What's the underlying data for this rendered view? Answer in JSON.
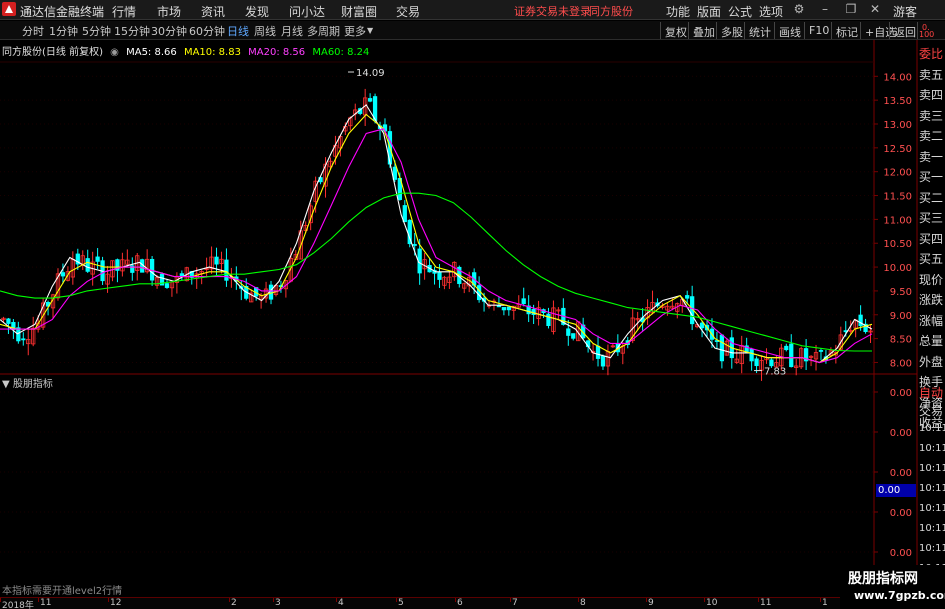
{
  "app": {
    "title": "通达信金融终端",
    "menu": [
      "行情",
      "市场",
      "资讯",
      "发现",
      "问小达",
      "财富圈",
      "交易"
    ],
    "notice": "证券交易未登录",
    "notice_stock": "同方股份",
    "right_menu": [
      "功能",
      "版面",
      "公式",
      "选项"
    ],
    "user": "游客"
  },
  "periods": {
    "tabs": [
      "分时",
      "1分钟",
      "5分钟",
      "15分钟",
      "30分钟",
      "60分钟",
      "日线",
      "周线",
      "月线",
      "多周期",
      "更多"
    ],
    "active": "日线"
  },
  "toolbar": [
    "复权",
    "叠加",
    "多股",
    "统计",
    "画线",
    "F10",
    "标记",
    "+自选",
    "返回"
  ],
  "chart_info": {
    "stock": "同方股份(日线 前复权)",
    "ma5_label": "MA5: 8.66",
    "ma10_label": "MA10: 8.83",
    "ma20_label": "MA20: 8.56",
    "ma60_label": "MA60: 8.24",
    "colors": {
      "ma5": "#ffffff",
      "ma10": "#ffff00",
      "ma20": "#ff00ff",
      "ma60": "#00ff00",
      "up": "#ff3030",
      "down": "#00ffff",
      "border": "#7a0000"
    }
  },
  "chart_data": {
    "type": "candlestick",
    "title": "同方股份(日线 前复权)",
    "y_ticks": [
      "14.00",
      "13.50",
      "13.00",
      "12.50",
      "12.00",
      "11.50",
      "11.00",
      "10.50",
      "10.00",
      "9.50",
      "9.00",
      "8.50",
      "8.00"
    ],
    "ylim": [
      7.8,
      14.3
    ],
    "x_ticks": [
      "2018年",
      "11",
      "12",
      "2",
      "3",
      "4",
      "5",
      "6",
      "7",
      "8",
      "9",
      "10",
      "11",
      "1"
    ],
    "annotations": {
      "high": "14.09",
      "low": "7.83"
    },
    "series": [
      {
        "name": "MA5",
        "values": [
          8.9,
          8.6,
          8.8,
          9.6,
          10.2,
          10.0,
          9.9,
          10.0,
          10.1,
          9.8,
          9.7,
          9.9,
          10.0,
          9.9,
          9.5,
          9.3,
          9.7,
          10.5,
          11.6,
          12.4,
          13.1,
          13.4,
          12.8,
          11.1,
          10.1,
          9.9,
          9.9,
          9.6,
          9.2,
          9.2,
          9.1,
          9.0,
          8.9,
          8.7,
          8.2,
          8.1,
          8.6,
          9.0,
          9.3,
          9.4,
          8.8,
          8.3,
          8.2,
          8.2,
          8.1,
          8.1,
          8.1,
          8.0,
          8.3,
          8.9,
          8.7
        ]
      },
      {
        "name": "MA10",
        "values": [
          8.8,
          8.7,
          8.7,
          9.3,
          9.9,
          10.1,
          10.0,
          10.0,
          10.0,
          9.9,
          9.8,
          9.8,
          9.9,
          9.9,
          9.6,
          9.4,
          9.5,
          10.2,
          11.2,
          12.1,
          12.8,
          13.2,
          12.9,
          11.8,
          10.5,
          10.0,
          9.9,
          9.7,
          9.3,
          9.2,
          9.1,
          9.0,
          8.9,
          8.8,
          8.4,
          8.2,
          8.4,
          8.9,
          9.2,
          9.4,
          9.0,
          8.5,
          8.3,
          8.2,
          8.1,
          8.1,
          8.1,
          8.0,
          8.2,
          8.7,
          8.8
        ]
      },
      {
        "name": "MA20",
        "values": [
          8.7,
          8.7,
          8.7,
          8.9,
          9.4,
          9.7,
          9.9,
          10.0,
          10.0,
          9.9,
          9.8,
          9.8,
          9.8,
          9.8,
          9.7,
          9.5,
          9.5,
          9.8,
          10.5,
          11.3,
          12.1,
          12.8,
          12.9,
          12.2,
          11.0,
          10.2,
          10.0,
          9.8,
          9.5,
          9.3,
          9.2,
          9.1,
          9.0,
          8.9,
          8.6,
          8.4,
          8.4,
          8.7,
          9.0,
          9.2,
          9.1,
          8.7,
          8.4,
          8.3,
          8.2,
          8.1,
          8.1,
          8.0,
          8.1,
          8.4,
          8.6
        ]
      },
      {
        "name": "MA60",
        "values": [
          9.5,
          9.4,
          9.35,
          9.35,
          9.4,
          9.5,
          9.55,
          9.6,
          9.65,
          9.65,
          9.7,
          9.75,
          9.8,
          9.85,
          9.85,
          9.9,
          9.95,
          10.05,
          10.3,
          10.6,
          10.95,
          11.25,
          11.45,
          11.55,
          11.55,
          11.5,
          11.35,
          11.05,
          10.7,
          10.35,
          10.05,
          9.8,
          9.6,
          9.45,
          9.35,
          9.25,
          9.15,
          9.1,
          9.05,
          9.0,
          8.95,
          8.85,
          8.75,
          8.65,
          8.55,
          8.45,
          8.35,
          8.3,
          8.25,
          8.24,
          8.24
        ]
      }
    ]
  },
  "indicator": {
    "title": "股朋指标",
    "note": "本指标需要开通level2行情",
    "y_ticks": [
      "0.00",
      "0.00",
      "0.00",
      "0.00",
      "0.00"
    ],
    "selected_value": "0.00"
  },
  "side_panel": {
    "header": [
      "0.",
      "100"
    ],
    "labels": [
      "委比",
      "卖五",
      "卖四",
      "卖三",
      "卖二",
      "卖一",
      "买一",
      "买二",
      "买三",
      "买四",
      "买五",
      "现价",
      "涨跌",
      "涨幅",
      "总量",
      "外盘",
      "换手",
      "净资",
      "收益"
    ],
    "label2": [
      "自动",
      "交易"
    ],
    "times": [
      "10:11",
      "10:11",
      "10:11",
      "10:11",
      "10:11",
      "10:11",
      "10:11",
      "10:11",
      "10:12"
    ]
  },
  "watermark": {
    "main": "股朋指标网",
    "sub": "www.7gpzb.com"
  }
}
